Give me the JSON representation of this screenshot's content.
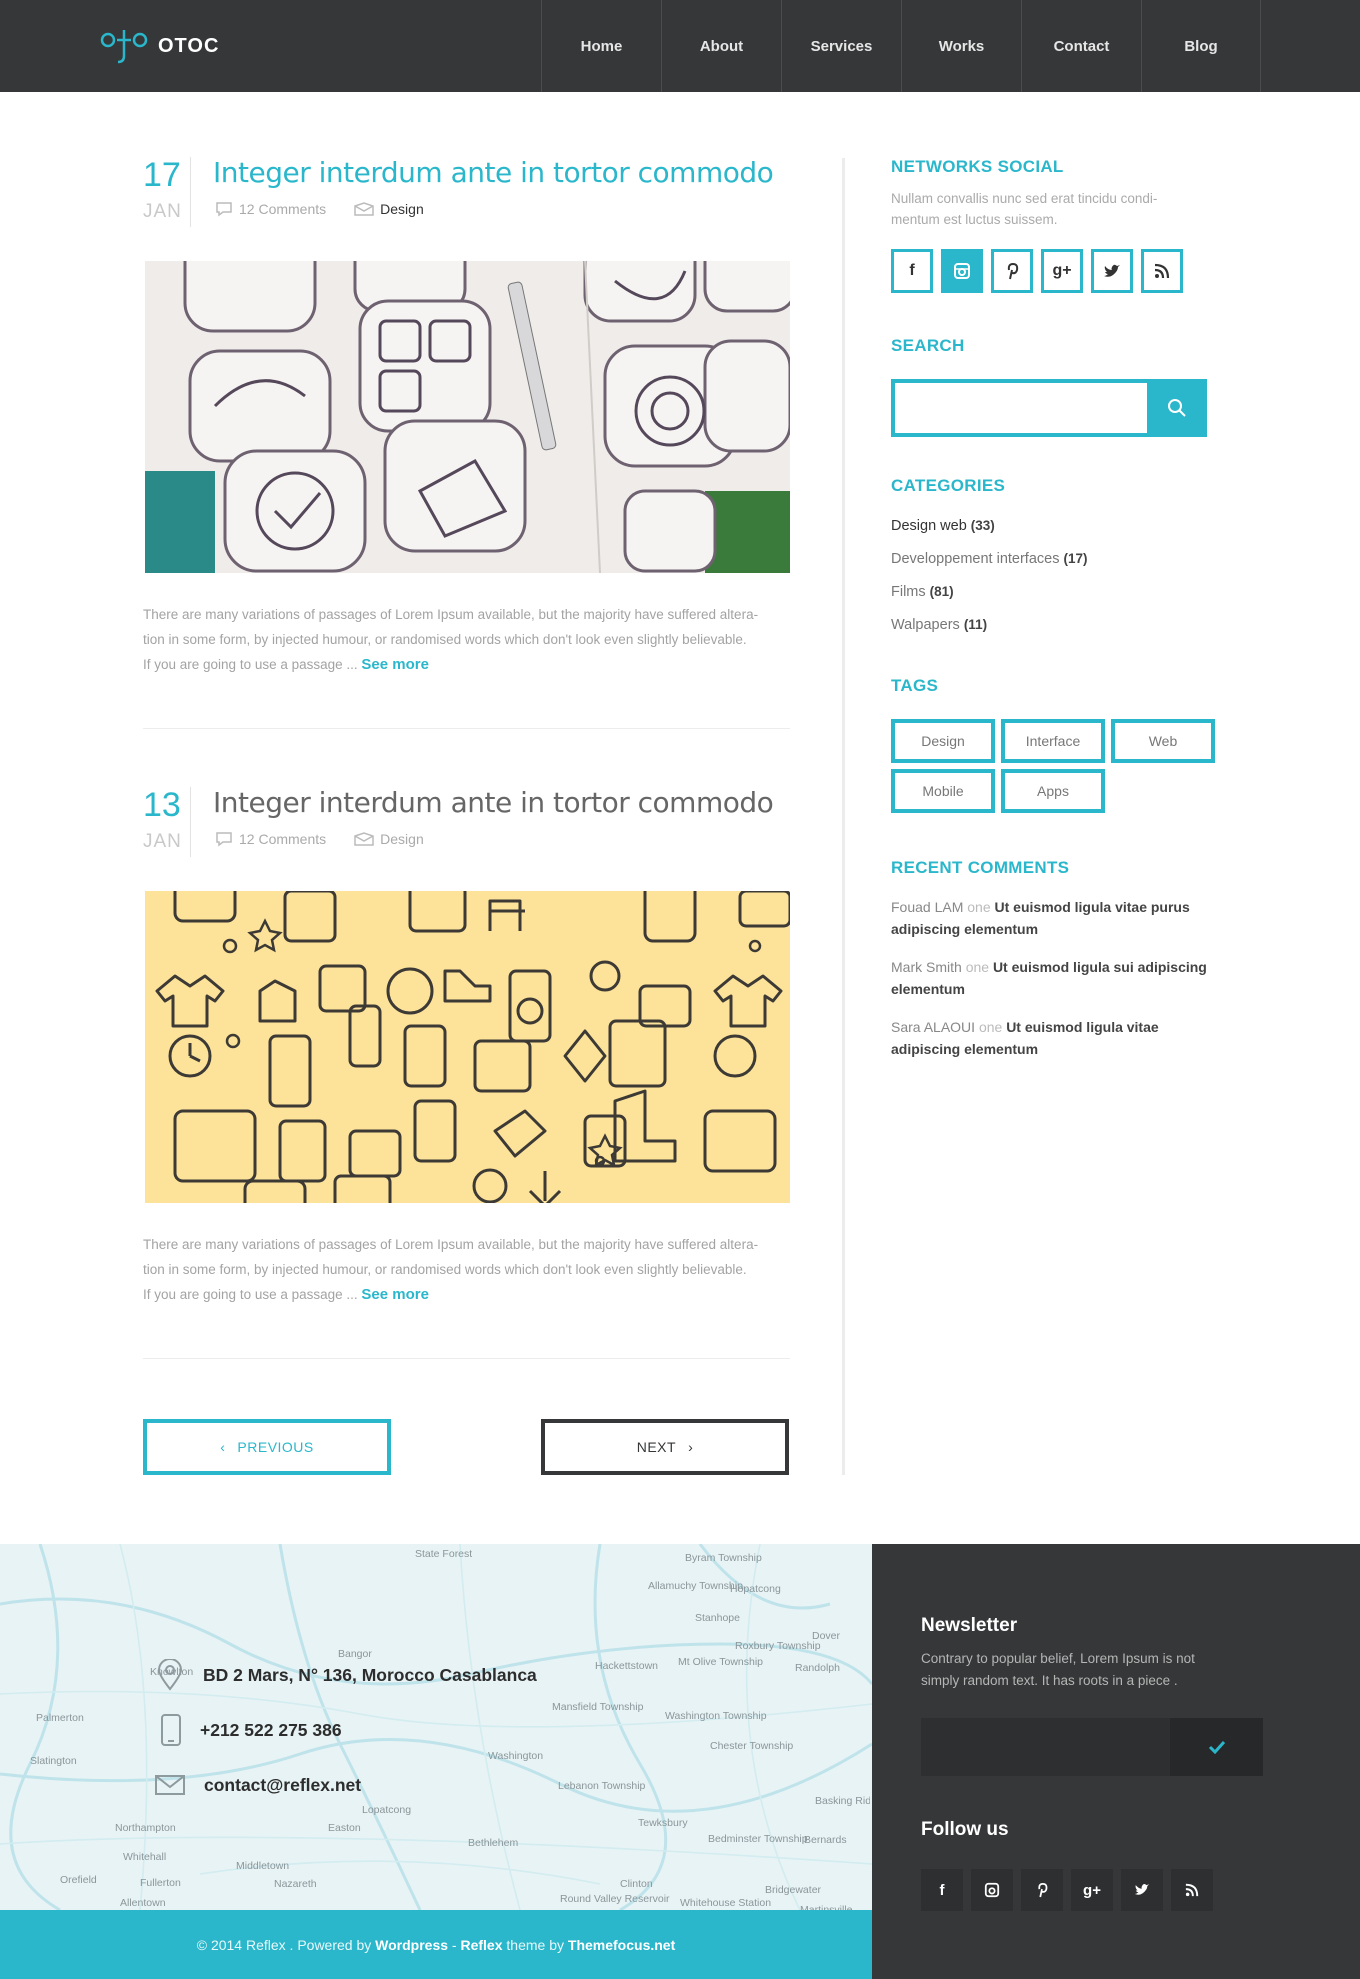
{
  "colors": {
    "accent": "#2bb7cb",
    "dark": "#353738",
    "post2_image_bg": "#fde39a"
  },
  "header": {
    "logo_mark": "oto",
    "logo_word": "OTOC",
    "nav": [
      "Home",
      "About",
      "Services",
      "Works",
      "Contact",
      "Blog"
    ]
  },
  "posts": [
    {
      "day": "17",
      "month": "JAN",
      "title": "Integer interdum ante in tortor commodo",
      "comments": "12 Comments",
      "category": "Design",
      "excerpt_lines": [
        "There are many variations of passages of Lorem Ipsum available, but the majority have suffered altera-",
        "tion in some form, by injected humour, or randomised words which don't look even slightly believable.",
        "If you are going to use a passage ..."
      ],
      "see_more": "See more",
      "image": "sketched-app-icons-photo"
    },
    {
      "day": "13",
      "month": "JAN",
      "title": "Integer interdum ante in tortor commodo",
      "comments": "12 Comments",
      "category": "Design",
      "excerpt_lines": [
        "There are many variations of passages of Lorem Ipsum available, but the majority have suffered altera-",
        "tion in some form, by injected humour, or randomised words which don't look even slightly believable.",
        "If you are going to use a passage ..."
      ],
      "see_more": "See more",
      "image": "yellow-icon-pattern"
    }
  ],
  "pagination": {
    "previous": "PREVIOUS",
    "next": "NEXT"
  },
  "sidebar": {
    "social": {
      "title": "NETWORKS SOCIAL",
      "text_lines": [
        "Nullam convallis nunc sed erat tincidu condi-",
        "mentum est luctus suissem."
      ],
      "icons": [
        {
          "name": "facebook-icon",
          "glyph": "f"
        },
        {
          "name": "instagram-icon",
          "glyph": "◙"
        },
        {
          "name": "pinterest-icon",
          "glyph": "℘"
        },
        {
          "name": "google-plus-icon",
          "glyph": "g+"
        },
        {
          "name": "twitter-icon",
          "glyph": "♥"
        },
        {
          "name": "rss-icon",
          "glyph": "◥"
        }
      ]
    },
    "search": {
      "title": "SEARCH",
      "placeholder": ""
    },
    "categories": {
      "title": "CATEGORIES",
      "items": [
        {
          "label": "Design web",
          "count": "(33)"
        },
        {
          "label": "Developpement interfaces",
          "count": "(17)"
        },
        {
          "label": "Films",
          "count": "(81)"
        },
        {
          "label": "Walpapers",
          "count": "(11)"
        }
      ]
    },
    "tags": {
      "title": "TAGS",
      "items": [
        "Design",
        "Interface",
        "Web",
        "Mobile",
        "Apps"
      ]
    },
    "recent_comments": {
      "title": "RECENT COMMENTS",
      "items": [
        {
          "author": "Fouad LAM",
          "sep": "one",
          "text": "Ut euismod ligula vitae purus adipiscing elementum"
        },
        {
          "author": "Mark Smith",
          "sep": "one",
          "text": "Ut euismod ligula sui adipiscing elementum"
        },
        {
          "author": "Sara ALAOUI",
          "sep": "one",
          "text": "Ut euismod ligula vitae adipiscing elementum"
        }
      ]
    }
  },
  "footer": {
    "contact": {
      "address": "BD 2 Mars, N° 136, Morocco Casablanca",
      "phone": "+212 522 275 386",
      "email": "contact@reflex.net"
    },
    "newsletter": {
      "title": "Newsletter",
      "text_lines": [
        "Contrary to popular belief, Lorem Ipsum is not",
        "simply random text. It has roots in a piece ."
      ],
      "placeholder": ""
    },
    "follow": {
      "title": "Follow us"
    },
    "copyright": {
      "prefix": "© 2014 Reflex . Powered by ",
      "wordpress": "Wordpress",
      "dash": " - ",
      "reflex": "Reflex",
      "theme_by": " theme by ",
      "themefocus": "Themefocus.net"
    },
    "map_labels": [
      "State Forest",
      "Byram Township",
      "Allamuchy Township",
      "Hopatcong",
      "Stanhope",
      "Roxbury Township",
      "Dover",
      "Hackettstown",
      "Mt Olive Township",
      "Randolph",
      "Bangor",
      "Knowlton",
      "Mansfield Township",
      "Washington Township",
      "Chester Township",
      "Palmerton",
      "Washington",
      "Slatington",
      "Lebanon Township",
      "Basking Ridge",
      "Northampton",
      "Lopatcong",
      "Easton",
      "Tewksbury",
      "Bethlehem",
      "Bedminster Township",
      "Bernards",
      "Whitehall",
      "Middletown",
      "Fullerton",
      "Clinton",
      "Bridgewater",
      "Orefield",
      "Allentown",
      "Whitehouse Station",
      "Martinsville",
      "Nazareth",
      "Round Valley Reservoir"
    ]
  }
}
